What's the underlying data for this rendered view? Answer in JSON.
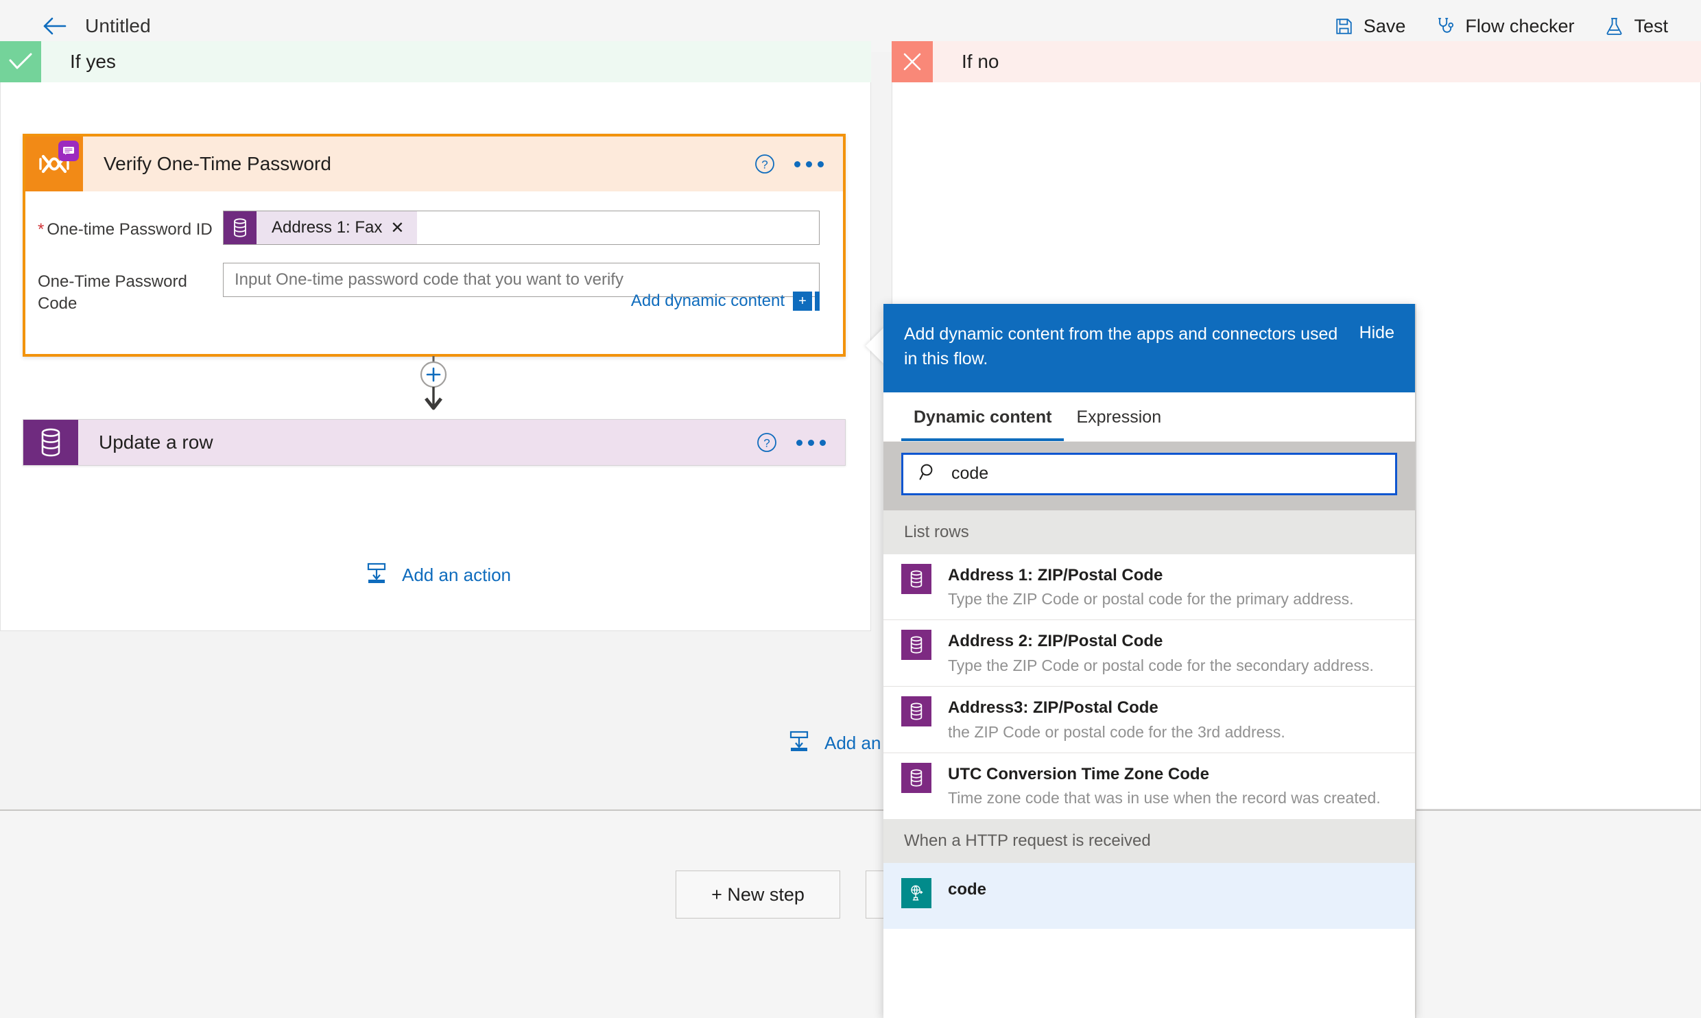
{
  "commandbar": {
    "back_icon": "arrow-left-icon",
    "title": "Untitled",
    "items": [
      {
        "label": "Save",
        "icon": "save-icon"
      },
      {
        "label": "Flow checker",
        "icon": "stethoscope-icon"
      },
      {
        "label": "Test",
        "icon": "flask-icon"
      }
    ]
  },
  "branches": {
    "yes": {
      "label": "If yes",
      "icon": "check-icon",
      "chip_color": "#74d39a",
      "bg": "#eef9f2"
    },
    "no": {
      "label": "If no",
      "icon": "close-icon",
      "chip_color": "#f98878",
      "bg": "#fdeeec"
    }
  },
  "verify_card": {
    "title": "Verify One-Time Password",
    "icon": "verify-otp-connector-icon",
    "badge_icon": "sms-badge-icon",
    "help_icon": "help-circle-icon",
    "more_icon": "ellipsis-icon",
    "accent": "#f28a16",
    "fields": [
      {
        "label": "One-time Password ID",
        "required": true,
        "token": {
          "text": "Address 1: Fax",
          "icon": "dataverse-icon",
          "remove_icon": "close-icon"
        }
      },
      {
        "label": "One-Time Password Code",
        "required": false,
        "placeholder": "Input One-time password code that you want to verify"
      }
    ],
    "dynamic_link": {
      "label": "Add dynamic content",
      "plus": "+"
    }
  },
  "connector": {
    "plus_icon": "plus-circle-icon",
    "arrow_icon": "arrow-down-icon"
  },
  "update_card": {
    "title": "Update a row",
    "icon": "dataverse-icon",
    "help_icon": "help-circle-icon",
    "more_icon": "ellipsis-icon"
  },
  "add_actions": {
    "yes_label": "Add an action",
    "no_label": "Add an a",
    "icon": "insert-below-icon"
  },
  "bottom": {
    "new_step_label": "+ New step",
    "save_draft_label": ""
  },
  "flyout": {
    "header_text": "Add dynamic content from the apps and connectors used in this flow.",
    "hide_label": "Hide",
    "tabs": [
      {
        "label": "Dynamic content",
        "active": true
      },
      {
        "label": "Expression",
        "active": false
      }
    ],
    "search": {
      "value": "code",
      "placeholder": "",
      "icon": "search-icon"
    },
    "groups": [
      {
        "title": "List rows",
        "items": [
          {
            "name": "Address 1: ZIP/Postal Code",
            "desc": "Type the ZIP Code or postal code for the primary address.",
            "icon": "dataverse-icon",
            "icon_kind": "dataverse",
            "selected": false
          },
          {
            "name": "Address 2: ZIP/Postal Code",
            "desc": "Type the ZIP Code or postal code for the secondary address.",
            "icon": "dataverse-icon",
            "icon_kind": "dataverse",
            "selected": false
          },
          {
            "name": "Address3: ZIP/Postal Code",
            "desc": "the ZIP Code or postal code for the 3rd address.",
            "icon": "dataverse-icon",
            "icon_kind": "dataverse",
            "selected": false
          },
          {
            "name": "UTC Conversion Time Zone Code",
            "desc": "Time zone code that was in use when the record was created.",
            "icon": "dataverse-icon",
            "icon_kind": "dataverse",
            "selected": false
          }
        ]
      },
      {
        "title": "When a HTTP request is received",
        "items": [
          {
            "name": "code",
            "desc": "",
            "icon": "http-request-icon",
            "icon_kind": "http",
            "selected": true
          }
        ]
      }
    ]
  }
}
